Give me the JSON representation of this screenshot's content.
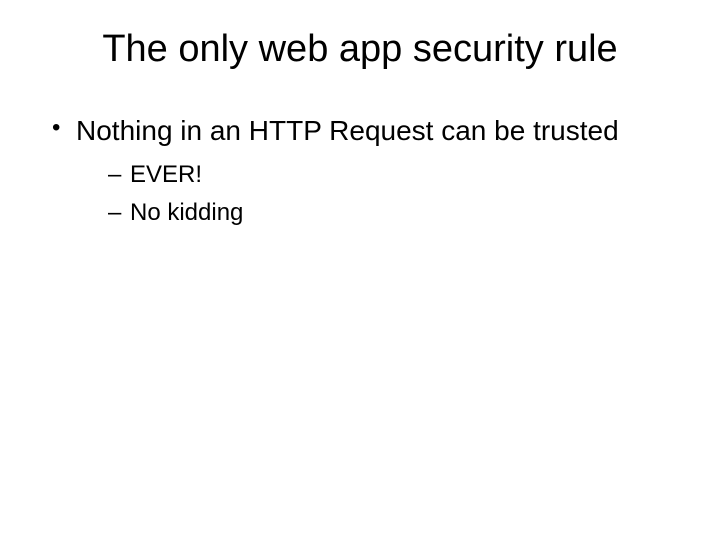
{
  "slide": {
    "title": "The only web app security rule",
    "bullets": [
      {
        "text": "Nothing in an HTTP Request can be trusted",
        "subitems": [
          "EVER!",
          "No kidding"
        ]
      }
    ]
  }
}
